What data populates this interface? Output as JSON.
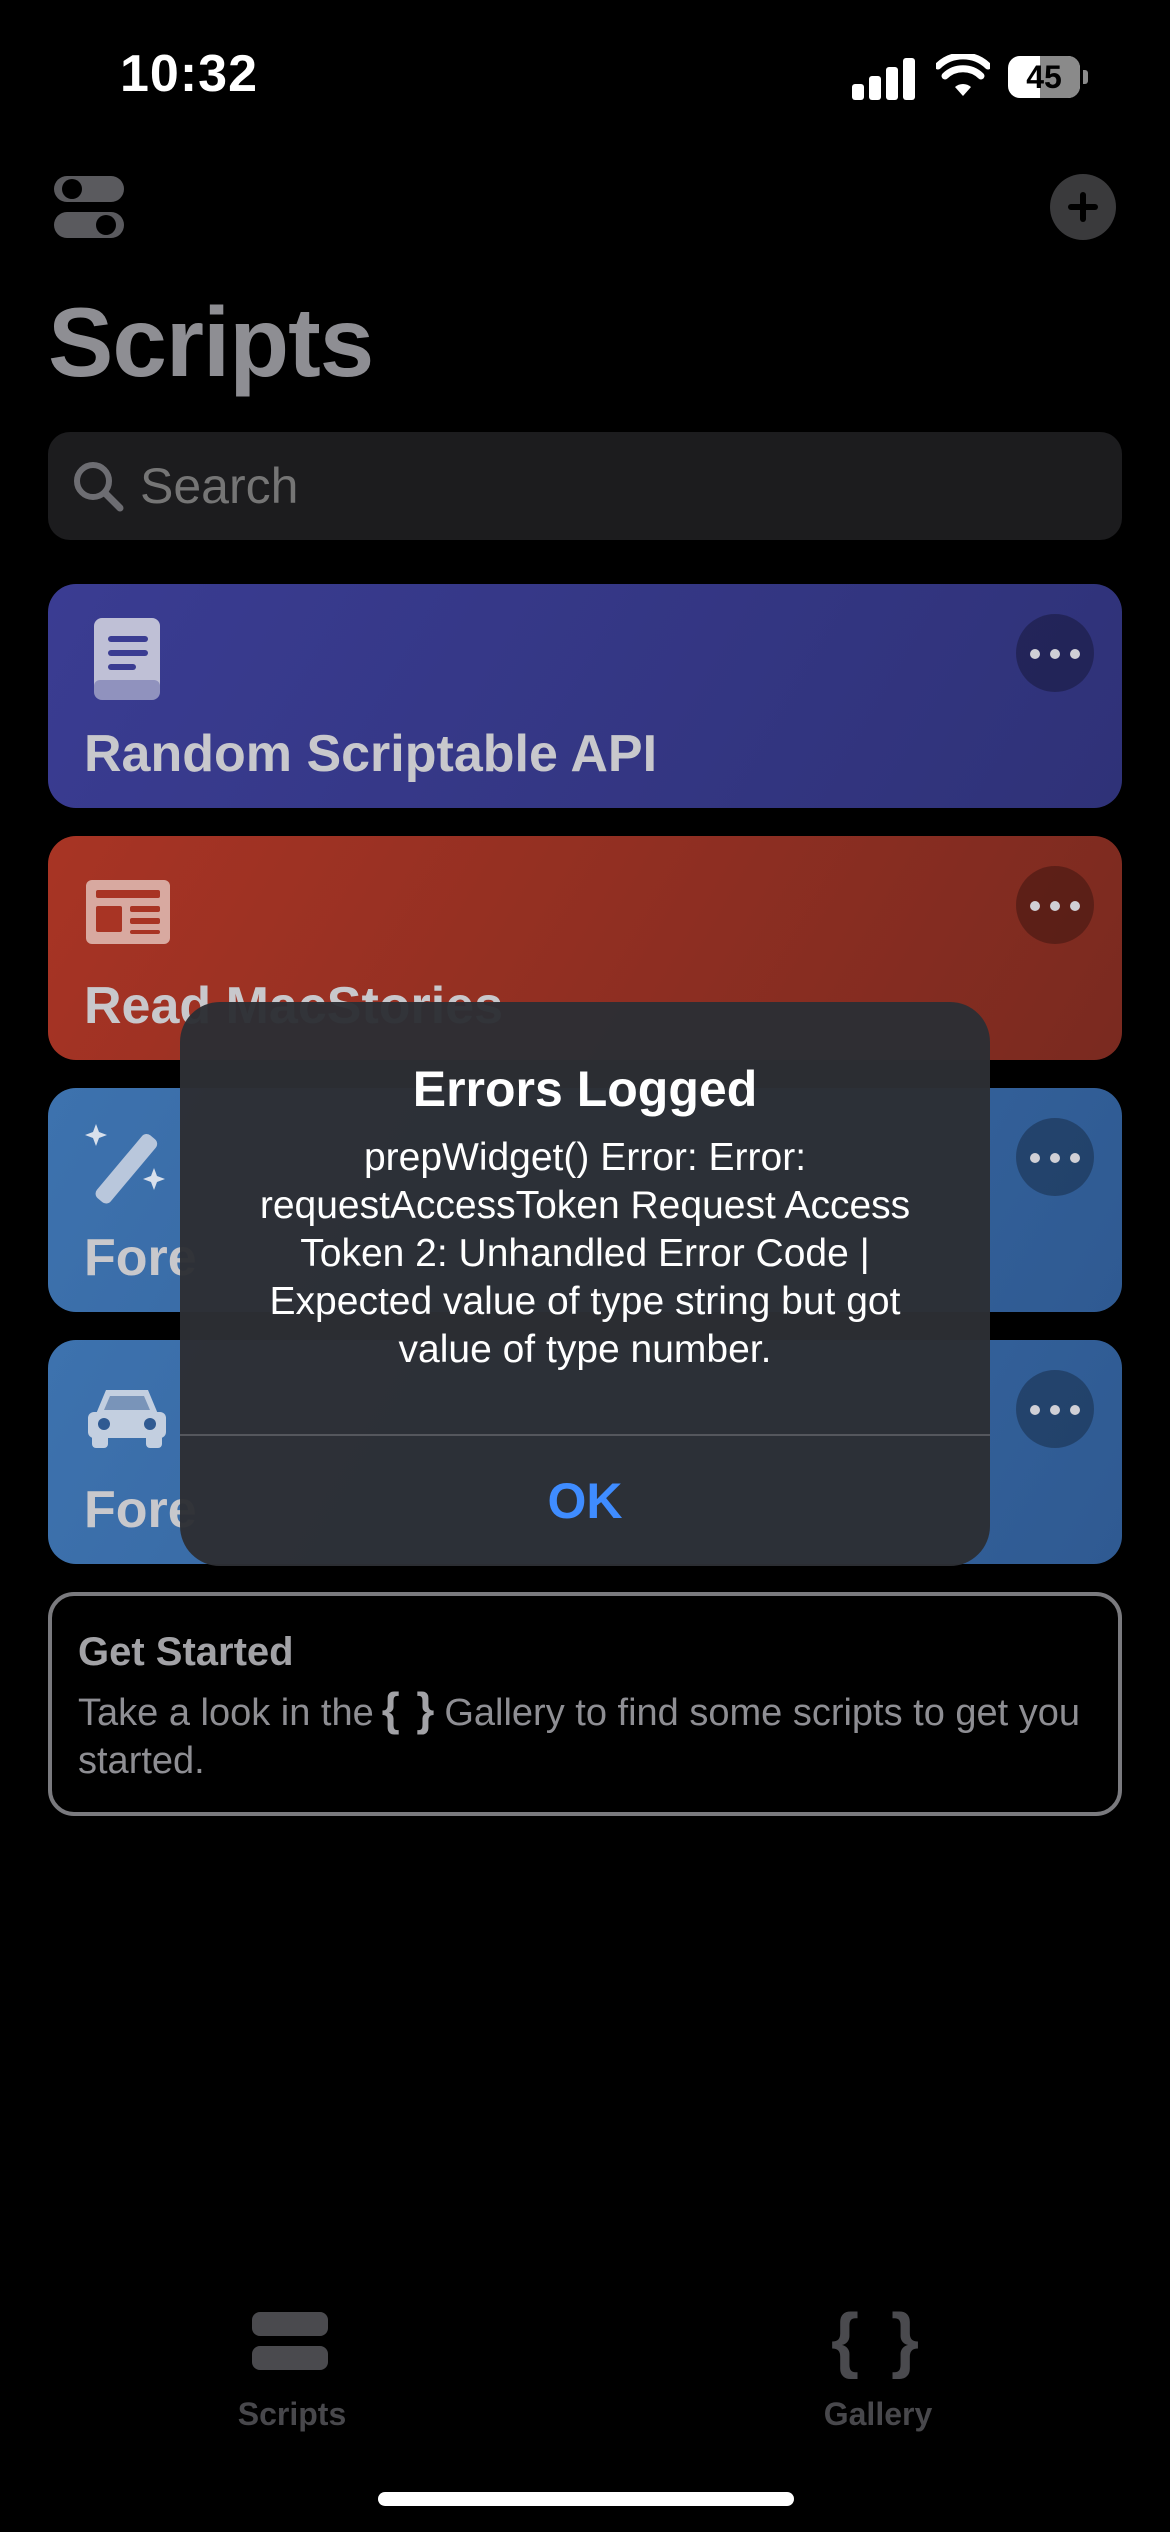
{
  "status_bar": {
    "time": "10:32",
    "battery_level": "45"
  },
  "header": {
    "title": "Scripts"
  },
  "search": {
    "placeholder": "Search"
  },
  "scripts": [
    {
      "title": "Random Scriptable API",
      "icon": "book-icon",
      "color": "#3a3c92"
    },
    {
      "title": "Read MacStories",
      "icon": "newspaper-icon",
      "color": "#a83424"
    },
    {
      "title": "Fore",
      "icon": "magic-wand-icon",
      "color": "#3d72ae"
    },
    {
      "title": "Fore",
      "icon": "car-icon",
      "color": "#3d72ae"
    }
  ],
  "get_started": {
    "title": "Get Started",
    "text_before": "Take a look in the",
    "braces": "{ }",
    "text_after": "Gallery to find some scripts to get you started."
  },
  "tabs": [
    {
      "label": "Scripts",
      "icon": "stack-icon"
    },
    {
      "label": "Gallery",
      "icon": "braces-icon",
      "glyph": "{ }"
    }
  ],
  "alert": {
    "title": "Errors Logged",
    "message": "prepWidget() Error: Error: requestAccessToken Request Access Token 2: Unhandled Error Code | Expected value of type string but got value of type number.",
    "ok_label": "OK",
    "accent_color": "#3f8cff"
  }
}
